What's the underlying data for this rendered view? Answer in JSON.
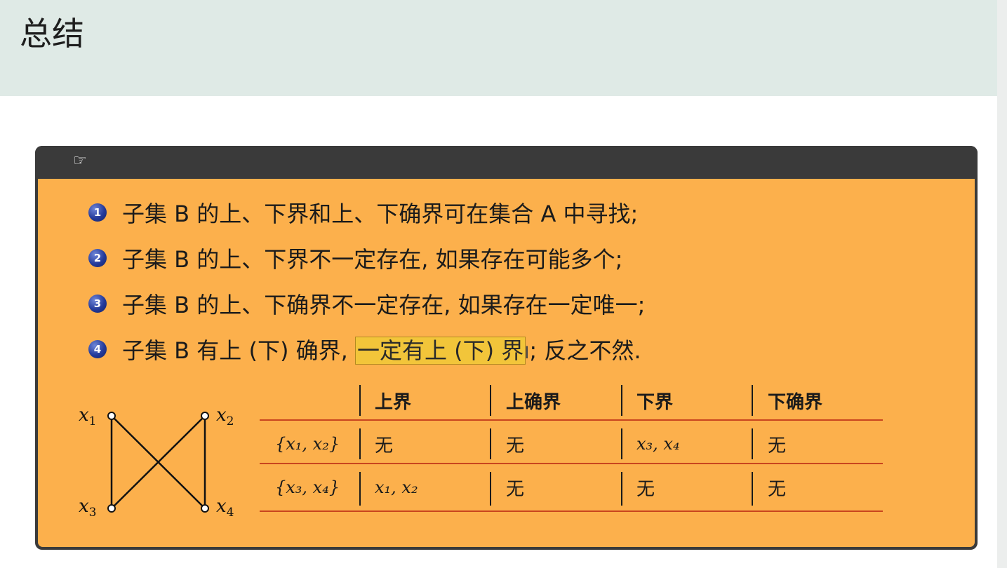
{
  "slide": {
    "title": "总结"
  },
  "box": {
    "header_icon": "☞",
    "items": [
      {
        "num": "1",
        "text": "子集 B 的上、下界和上、下确界可在集合 A 中寻找;"
      },
      {
        "num": "2",
        "text": "子集 B 的上、下界不一定存在, 如果存在可能多个;"
      },
      {
        "num": "3",
        "text": "子集 B 的上、下确界不一定存在, 如果存在一定唯一;"
      },
      {
        "num": "4",
        "text_before": "子集 B 有上 (下) 确界, ",
        "highlight": "一定有上 (下) 界",
        "cursor": "I",
        "text_after": "; 反之不然."
      }
    ]
  },
  "graph": {
    "nodes": [
      "x1",
      "x2",
      "x3",
      "x4"
    ],
    "labels": {
      "x1": {
        "base": "x",
        "sub": "1"
      },
      "x2": {
        "base": "x",
        "sub": "2"
      },
      "x3": {
        "base": "x",
        "sub": "3"
      },
      "x4": {
        "base": "x",
        "sub": "4"
      }
    }
  },
  "table": {
    "headers": [
      "上界",
      "上确界",
      "下界",
      "下确界"
    ],
    "rows": [
      {
        "set": "{x₁, x₂}",
        "cells": [
          "无",
          "无",
          "x₃, x₄",
          "无"
        ]
      },
      {
        "set": "{x₃, x₄}",
        "cells": [
          "x₁, x₂",
          "无",
          "无",
          "无"
        ]
      }
    ]
  },
  "colors": {
    "title_bar": "#dfeae6",
    "box_header": "#3a3a3a",
    "box_body": "#fcb04c",
    "highlight": "#f2c53a",
    "rule": "#c8451f",
    "bullet": "#243a9a"
  }
}
